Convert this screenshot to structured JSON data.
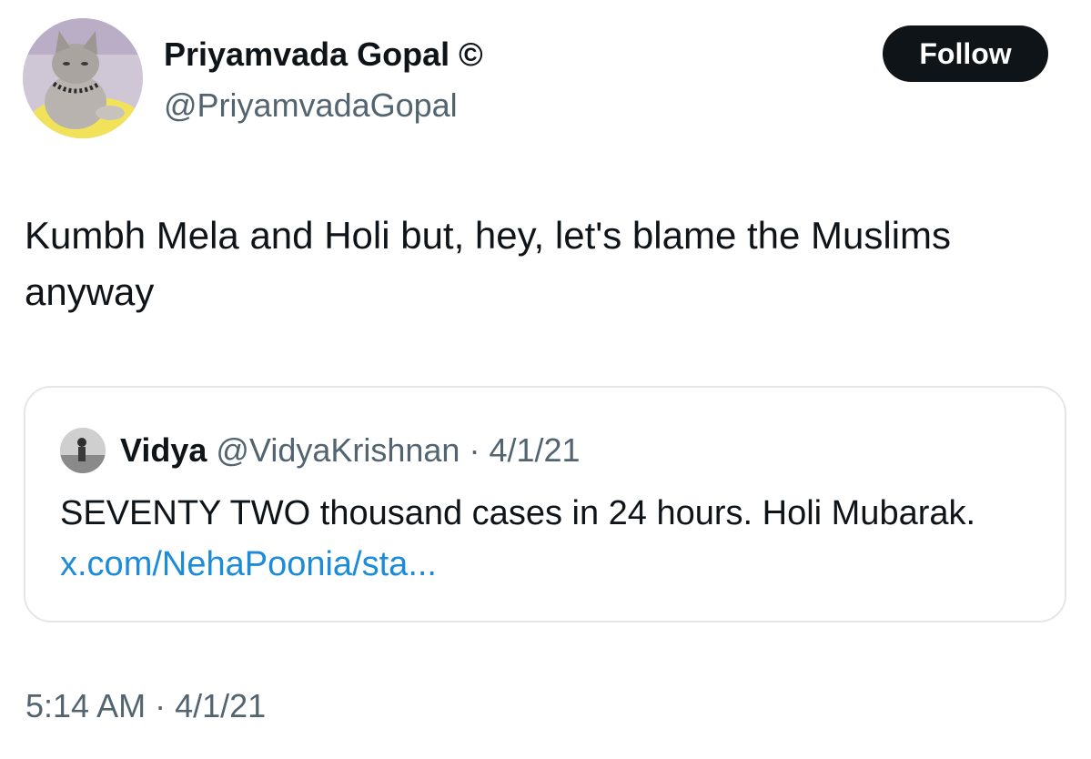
{
  "author": {
    "name": "Priyamvada Gopal ©",
    "handle": "@PriyamvadaGopal"
  },
  "follow_button": {
    "label": "Follow"
  },
  "tweet": {
    "text": "Kumbh Mela and Holi but, hey, let's blame the Muslims anyway"
  },
  "quote": {
    "name": "Vidya",
    "handle": "@VidyaKrishnan",
    "separator": " · ",
    "date": "4/1/21",
    "text": "SEVENTY TWO thousand cases in 24 hours. Holi Mubarak.",
    "link": "x.com/NehaPoonia/sta..."
  },
  "meta": {
    "time": "5:14 AM",
    "separator": " · ",
    "date": "4/1/21"
  },
  "colors": {
    "text": "#0f1419",
    "secondary": "#536471",
    "link": "#1d8cd8",
    "button_bg": "#0f1419",
    "border": "#e3e7ea"
  },
  "icons": {
    "author_avatar": "cat-avatar-icon",
    "quote_avatar": "person-avatar-icon"
  }
}
